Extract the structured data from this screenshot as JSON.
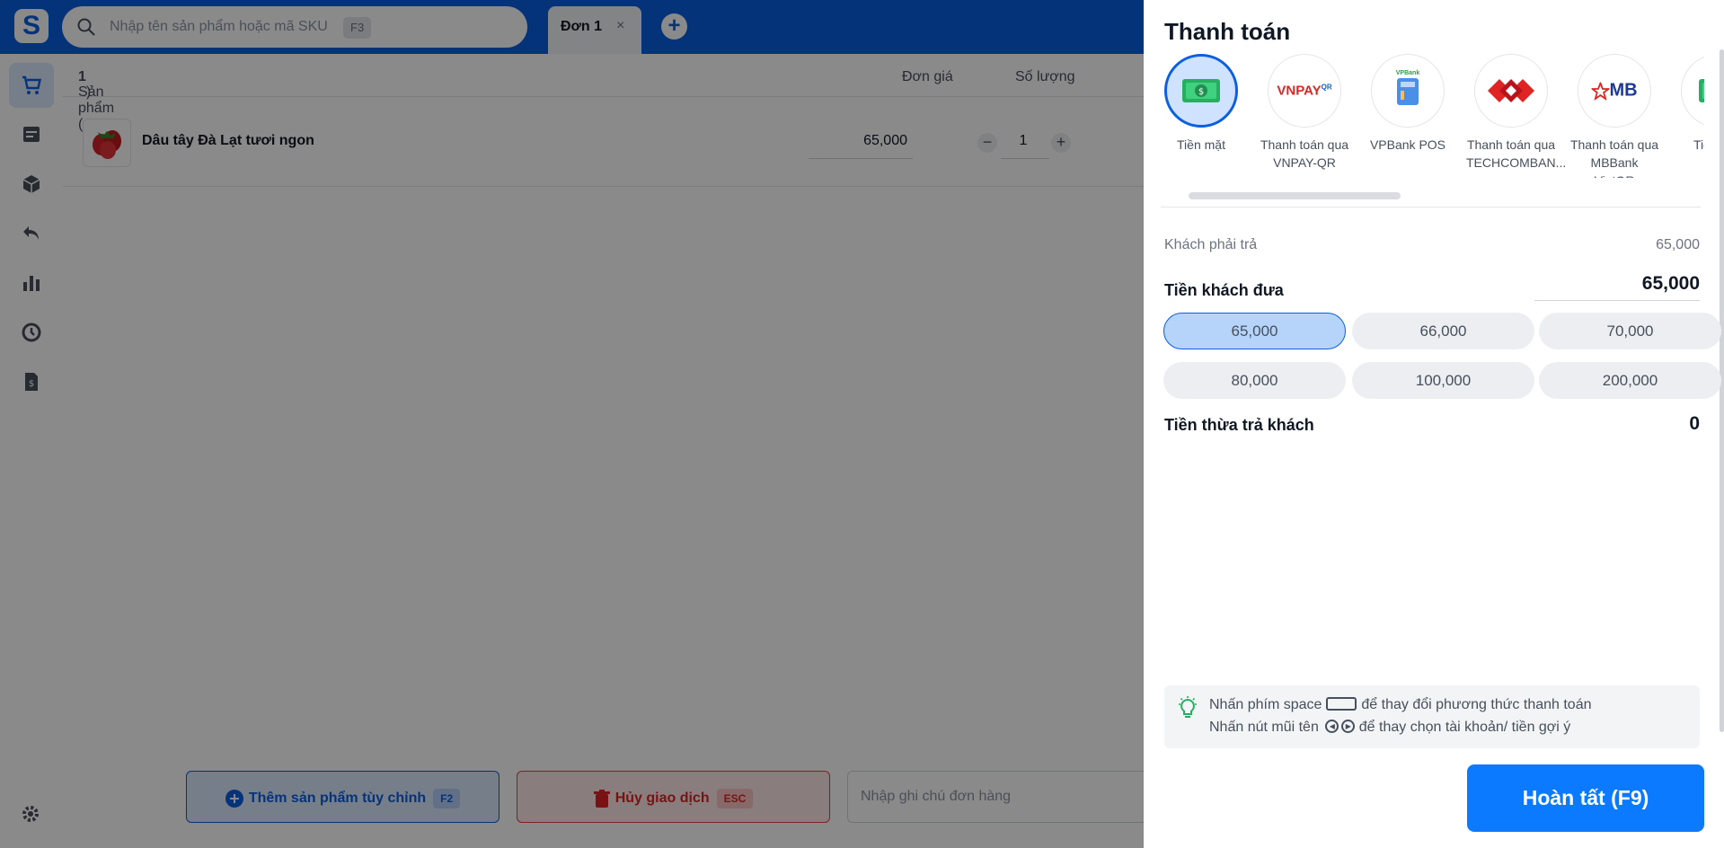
{
  "header": {
    "search_placeholder": "Nhập tên sản phẩm hoặc mã SKU",
    "search_shortcut": "F3",
    "tabs": [
      {
        "label": "Đơn 1",
        "close": "×"
      }
    ],
    "add_tab": "+"
  },
  "sidebar": {
    "items": [
      {
        "icon": "cart-icon",
        "active": true
      },
      {
        "icon": "orders-icon",
        "active": false
      },
      {
        "icon": "box-icon",
        "active": false
      },
      {
        "icon": "return-icon",
        "active": false
      },
      {
        "icon": "report-icon",
        "active": false
      },
      {
        "icon": "clock-icon",
        "active": false
      },
      {
        "icon": "invoice-icon",
        "active": false
      }
    ],
    "settings_icon": "gear-icon"
  },
  "cart": {
    "header_label": "Sản phẩm (",
    "header_count": "1",
    "header_close": ")",
    "col_price": "Đơn giá",
    "col_qty": "Số lượng",
    "items": [
      {
        "name": "Dâu tây Đà Lạt tươi ngon",
        "price": "65,000",
        "qty": "1",
        "minus": "−",
        "plus": "+"
      }
    ]
  },
  "footer": {
    "add_custom_label": "Thêm sản phẩm tùy chỉnh",
    "add_custom_shortcut": "F2",
    "cancel_label": "Hủy giao dịch",
    "cancel_shortcut": "ESC",
    "note_placeholder": "Nhập ghi chú đơn hàng"
  },
  "payment": {
    "title": "Thanh toán",
    "methods": [
      {
        "line1": "Tiền mặt",
        "line2": "",
        "icon": "cash-icon",
        "active": true
      },
      {
        "line1": "Thanh toán qua",
        "line2": "VNPAY-QR",
        "icon": "vnpay-logo",
        "logo_text": "VNPAY",
        "logo_sup": "QR",
        "active": false
      },
      {
        "line1": "VPBank POS",
        "line2": "",
        "icon": "vpbank-pos-icon",
        "logo_text": "VPBank",
        "active": false
      },
      {
        "line1": "Thanh toán qua",
        "line2": "TECHCOMBAN...",
        "icon": "techcombank-logo",
        "active": false
      },
      {
        "line1": "Thanh toán qua",
        "line2": "MBBank VietQR",
        "icon": "mbbank-logo",
        "logo_text": "MB",
        "active": false
      },
      {
        "line1": "Tiền mặt",
        "line2": "",
        "icon": "cash-icon",
        "active": false
      }
    ],
    "amount_due_label": "Khách phải trả",
    "amount_due": "65,000",
    "amount_given_label": "Tiền khách đưa",
    "amount_given": "65,000",
    "suggestions": [
      "65,000",
      "66,000",
      "70,000",
      "80,000",
      "100,000",
      "200,000"
    ],
    "selected_suggestion": "65,000",
    "change_label": "Tiền thừa trả khách",
    "change": "0",
    "tip_line1_a": "Nhấn phím space",
    "tip_line1_b": "để thay đổi phương thức thanh toán",
    "tip_line2_a": "Nhấn nút mũi tên",
    "tip_line2_b": "để thay chọn tài khoản/ tiền gợi ý",
    "finish_label": "Hoàn tất (F9)"
  },
  "colors": {
    "brand": "#0b5fe0",
    "primary_button": "#0b7aff",
    "danger": "#e02424",
    "selected_chip": "#b6d4fa"
  }
}
